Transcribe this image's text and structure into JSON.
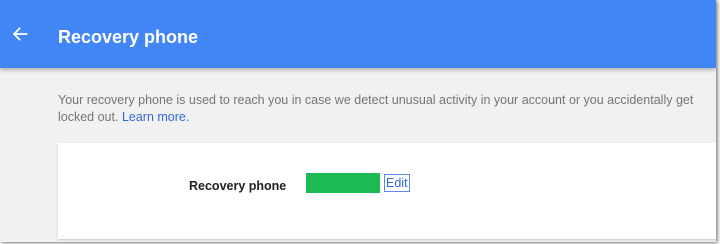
{
  "header": {
    "back_icon": "arrow-left-icon",
    "title": "Recovery phone",
    "background": "#4285f4"
  },
  "description": {
    "text": "Your recovery phone is used to reach you in case we detect unusual activity in your account or you accidentally get locked out.",
    "link_text": "Learn more."
  },
  "card": {
    "label": "Recovery phone",
    "phone_value": "",
    "phone_redaction_color": "#1db954",
    "edit_label": "Edit"
  }
}
